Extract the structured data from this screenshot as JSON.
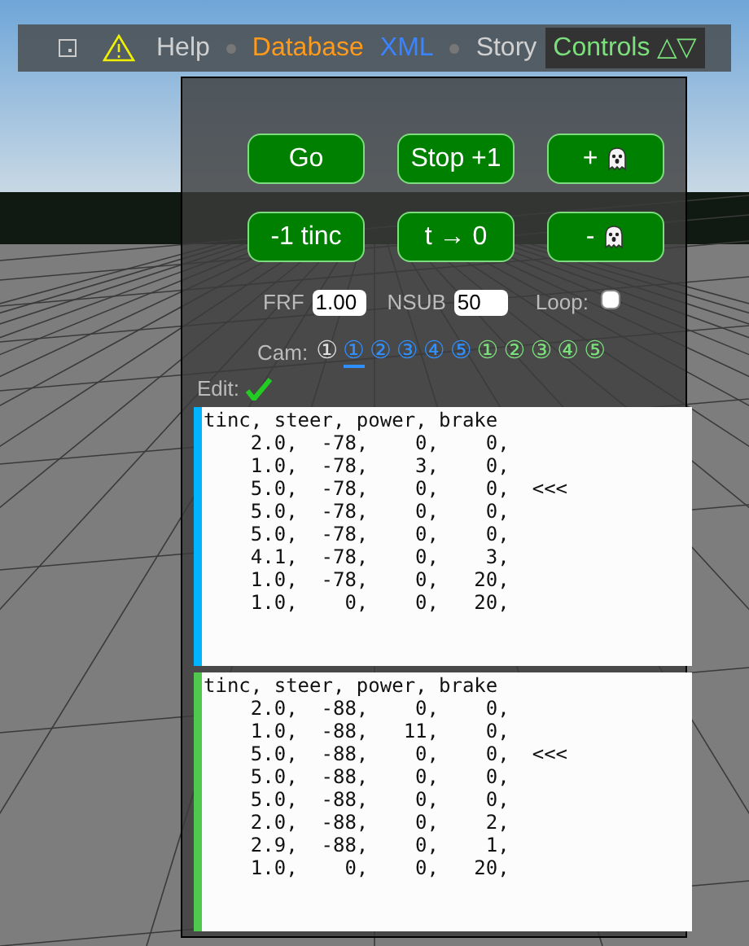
{
  "menu": [
    {
      "kind": "square"
    },
    {
      "kind": "warning"
    },
    {
      "kind": "link",
      "label": "Help",
      "color": "#d0d0d0"
    },
    {
      "kind": "dot"
    },
    {
      "kind": "link",
      "label": "Database",
      "color": "#ff9a1a"
    },
    {
      "kind": "link",
      "label": "XML",
      "color": "#3a84ff"
    },
    {
      "kind": "dot"
    },
    {
      "kind": "link",
      "label": "Story",
      "color": "#d0d0d0"
    },
    {
      "kind": "link",
      "label": "Controls △▽",
      "selected": true
    }
  ],
  "buttons": [
    {
      "kind": "text",
      "label": "Go"
    },
    {
      "kind": "text",
      "label": "Stop +1"
    },
    {
      "kind": "ghost",
      "label": "+"
    },
    {
      "kind": "text",
      "label": "-1 tinc"
    },
    {
      "kind": "text",
      "label": "t → 0"
    },
    {
      "kind": "ghost",
      "label": "-"
    }
  ],
  "settings": {
    "frf": {
      "label": "FRF",
      "value": "1.00"
    },
    "nsub": {
      "label": "NSUB",
      "value": "50"
    },
    "loop": {
      "label": "Loop:",
      "checked": false
    }
  },
  "cam": {
    "label": "Cam:",
    "options": [
      {
        "label": "①",
        "color": "#e0e0e0",
        "selected": false
      },
      {
        "label": "①",
        "color": "#2f8fff",
        "selected": true
      },
      {
        "label": "②",
        "color": "#2f8fff",
        "selected": false
      },
      {
        "label": "③",
        "color": "#2f8fff",
        "selected": false
      },
      {
        "label": "④",
        "color": "#2f8fff",
        "selected": false
      },
      {
        "label": "⑤",
        "color": "#2f8fff",
        "selected": false
      },
      {
        "label": "①",
        "color": "#7be07b",
        "selected": false
      },
      {
        "label": "②",
        "color": "#7be07b",
        "selected": false
      },
      {
        "label": "③",
        "color": "#7be07b",
        "selected": false
      },
      {
        "label": "④",
        "color": "#7be07b",
        "selected": false
      },
      {
        "label": "⑤",
        "color": "#7be07b",
        "selected": false
      }
    ]
  },
  "edit": {
    "label": "Edit:",
    "on": true
  },
  "scripts": [
    {
      "color": "#00b4ff",
      "lines": [
        {
          "text": "tinc, steer, power, brake"
        },
        {
          "text": "    2.0,  -78,    0,    0,"
        },
        {
          "text": "    1.0,  -78,    3,    0,"
        },
        {
          "text": "    5.0,  -78,    0,    0,",
          "marker": "<<<"
        },
        {
          "text": "    5.0,  -78,    0,    0,"
        },
        {
          "text": "    5.0,  -78,    0,    0,"
        },
        {
          "text": "    4.1,  -78,    0,    3,"
        },
        {
          "text": "    1.0,  -78,    0,   20,"
        },
        {
          "text": "    1.0,    0,    0,   20,"
        }
      ]
    },
    {
      "color": "#50c850",
      "lines": [
        {
          "text": "tinc, steer, power, brake"
        },
        {
          "text": "    2.0,  -88,    0,    0,"
        },
        {
          "text": "    1.0,  -88,   11,    0,"
        },
        {
          "text": "    5.0,  -88,    0,    0,",
          "marker": "<<<"
        },
        {
          "text": "    5.0,  -88,    0,    0,"
        },
        {
          "text": "    5.0,  -88,    0,    0,"
        },
        {
          "text": "    2.0,  -88,    0,    2,"
        },
        {
          "text": "    2.9,  -88,    0,    1,"
        },
        {
          "text": "    1.0,    0,    0,   20,"
        }
      ]
    }
  ]
}
